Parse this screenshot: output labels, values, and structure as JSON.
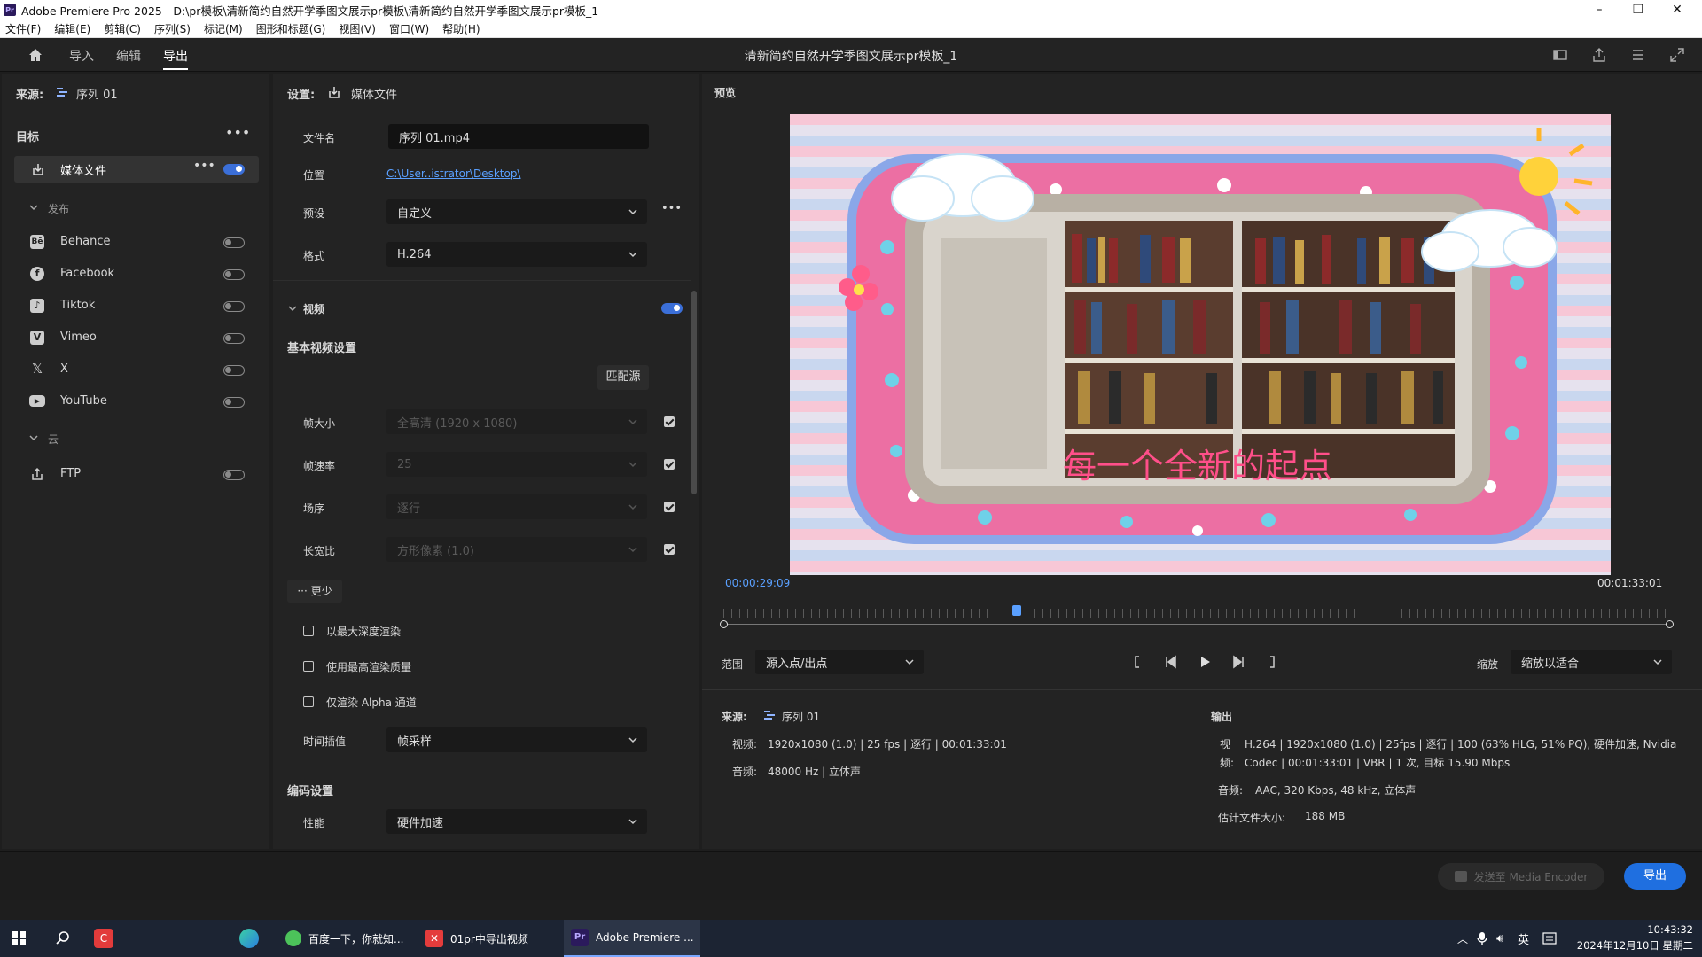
{
  "window": {
    "title": "Adobe Premiere Pro 2025 - D:\\pr模板\\清新简约自然开学季图文展示pr模板\\清新简约自然开学季图文展示pr模板_1"
  },
  "menu": [
    "文件(F)",
    "编辑(E)",
    "剪辑(C)",
    "序列(S)",
    "标记(M)",
    "图形和标题(G)",
    "视图(V)",
    "窗口(W)",
    "帮助(H)"
  ],
  "header": {
    "tabs": [
      "导入",
      "编辑",
      "导出"
    ],
    "active_tab": "导出",
    "project_title": "清新简约自然开学季图文展示pr模板_1"
  },
  "source_panel": {
    "label": "来源:",
    "sequence": "序列 01",
    "target_title": "目标",
    "media_file": "媒体文件",
    "publish_group": "发布",
    "publish_items": [
      "Behance",
      "Facebook",
      "Tiktok",
      "Vimeo",
      "X",
      "YouTube"
    ],
    "cloud_group": "云",
    "cloud_items": [
      "FTP"
    ]
  },
  "settings": {
    "label": "设置:",
    "section": "媒体文件",
    "filename_label": "文件名",
    "filename": "序列 01.mp4",
    "location_label": "位置",
    "location": "C:\\User..istrator\\Desktop\\",
    "preset_label": "预设",
    "preset": "自定义",
    "format_label": "格式",
    "format": "H.264",
    "video_section": "视频",
    "basic_video": "基本视频设置",
    "match_source": "匹配源",
    "frame_size_label": "帧大小",
    "frame_size": "全高清 (1920 x 1080)",
    "frame_rate_label": "帧速率",
    "frame_rate": "25",
    "field_order_label": "场序",
    "field_order": "逐行",
    "aspect_label": "长宽比",
    "aspect": "方形像素 (1.0)",
    "less": "··· 更少",
    "opt_max_depth": "以最大深度渲染",
    "opt_max_quality": "使用最高渲染质量",
    "opt_alpha": "仅渲染 Alpha 通道",
    "time_interp_label": "时间插值",
    "time_interp": "帧采样",
    "encoding_section": "编码设置",
    "performance_label": "性能",
    "performance": "硬件加速"
  },
  "preview": {
    "label": "预览",
    "overlay_text": "每一个全新的起点",
    "timecode_current": "00:00:29:09",
    "timecode_end": "00:01:33:01",
    "playhead_fraction": 0.31,
    "range_label": "范围",
    "range_value": "源入点/出点",
    "zoom_label": "缩放",
    "zoom_value": "缩放以适合"
  },
  "summary": {
    "source_label": "来源:",
    "source_seq": "序列 01",
    "video_label": "视频:",
    "video_value": "1920x1080 (1.0)  |  25 fps  |  逐行  |  00:01:33:01",
    "audio_label": "音频:",
    "audio_value": "48000 Hz  |  立体声",
    "output_label": "输出",
    "out_video_label": "视",
    "out_video_value": "H.264  |  1920x1080 (1.0)  |  25fps  |  逐行  |  100 (63% HLG, 51% PQ), 硬件加速, Nvidia",
    "out_codec_label": "频:",
    "out_codec_value": "Codec  |  00:01:33:01  |  VBR  |  1 次, 目标 15.90 Mbps",
    "out_audio_label": "音频:",
    "out_audio_value": "AAC, 320 Kbps, 48 kHz, 立体声",
    "size_label": "估计文件大小:",
    "size_value": "188 MB"
  },
  "footer": {
    "media_encoder": "发送至 Media Encoder",
    "export": "导出"
  },
  "taskbar": {
    "items": [
      "百度一下，你就知...",
      "01pr中导出视频",
      "Adobe Premiere ..."
    ],
    "ime": "英",
    "time": "10:43:32",
    "date": "2024年12月10日 星期二"
  },
  "colors": {
    "accent": "#3b6fd8",
    "timecode": "#5aa0ff",
    "export_button": "#1f6fe0",
    "panel": "#232323"
  }
}
